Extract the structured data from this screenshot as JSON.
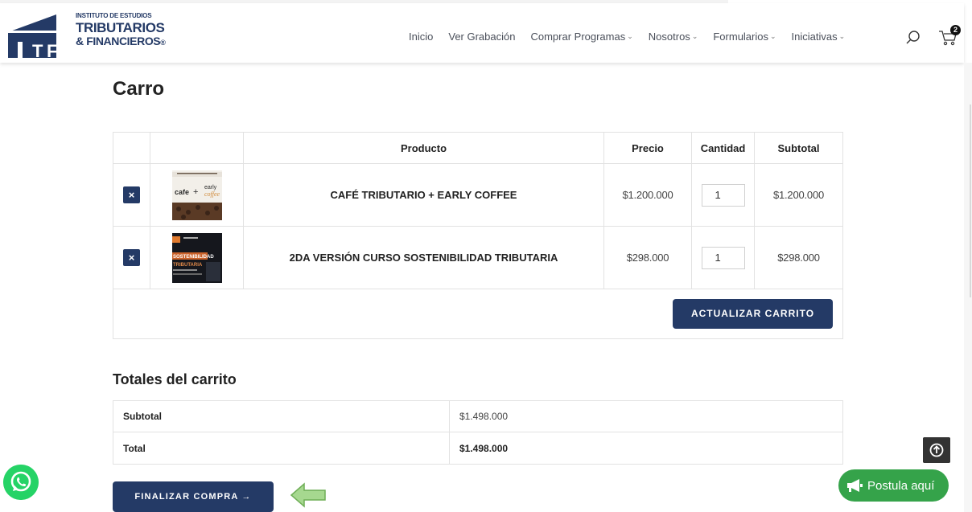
{
  "brand": {
    "line1": "INSTITUTO DE ESTUDIOS",
    "line2": "TRIBUTARIOS",
    "line3": "& FINANCIEROS",
    "registered": "®",
    "mark_letters": [
      "I",
      "T",
      "F"
    ],
    "color": "#243a66"
  },
  "nav": {
    "items": [
      {
        "label": "Inicio",
        "has_dropdown": false
      },
      {
        "label": "Ver Grabación",
        "has_dropdown": false
      },
      {
        "label": "Comprar Programas",
        "has_dropdown": true
      },
      {
        "label": "Nosotros",
        "has_dropdown": true
      },
      {
        "label": "Formularios",
        "has_dropdown": true
      },
      {
        "label": "Iniciativas",
        "has_dropdown": true
      }
    ],
    "chevron": "⌄"
  },
  "header_icons": {
    "search": "search-icon",
    "cart": "cart-icon",
    "cart_count": "2"
  },
  "page": {
    "title": "Carro"
  },
  "cart": {
    "columns": [
      "",
      "",
      "Producto",
      "Precio",
      "Cantidad",
      "Subtotal"
    ],
    "items": [
      {
        "remove": "×",
        "name": "CAFÉ TRIBUTARIO + EARLY COFFEE",
        "price": "$1.200.000",
        "quantity": "1",
        "subtotal": "$1.200.000",
        "thumb_text": [
          "cafe",
          "+",
          "early",
          "coffee"
        ]
      },
      {
        "remove": "×",
        "name": "2DA VERSIÓN CURSO SOSTENIBILIDAD TRIBUTARIA",
        "price": "$298.000",
        "quantity": "1",
        "subtotal": "$298.000",
        "thumb_text": [
          "SOSTENIBILIDAD",
          "TRIBUTARIA"
        ]
      }
    ],
    "update_label": "ACTUALIZAR CARRITO"
  },
  "totals": {
    "title": "Totales del carrito",
    "rows": [
      {
        "label": "Subtotal",
        "value": "$1.498.000"
      },
      {
        "label": "Total",
        "value": "$1.498.000"
      }
    ]
  },
  "checkout": {
    "label": "FINALIZAR COMPRA →"
  },
  "floating": {
    "postula_label": "Postula aquí",
    "accent_green": "#35a34a",
    "whatsapp_green": "#25d366"
  },
  "colors": {
    "primary": "#243a66",
    "border": "#e2e2e2"
  }
}
